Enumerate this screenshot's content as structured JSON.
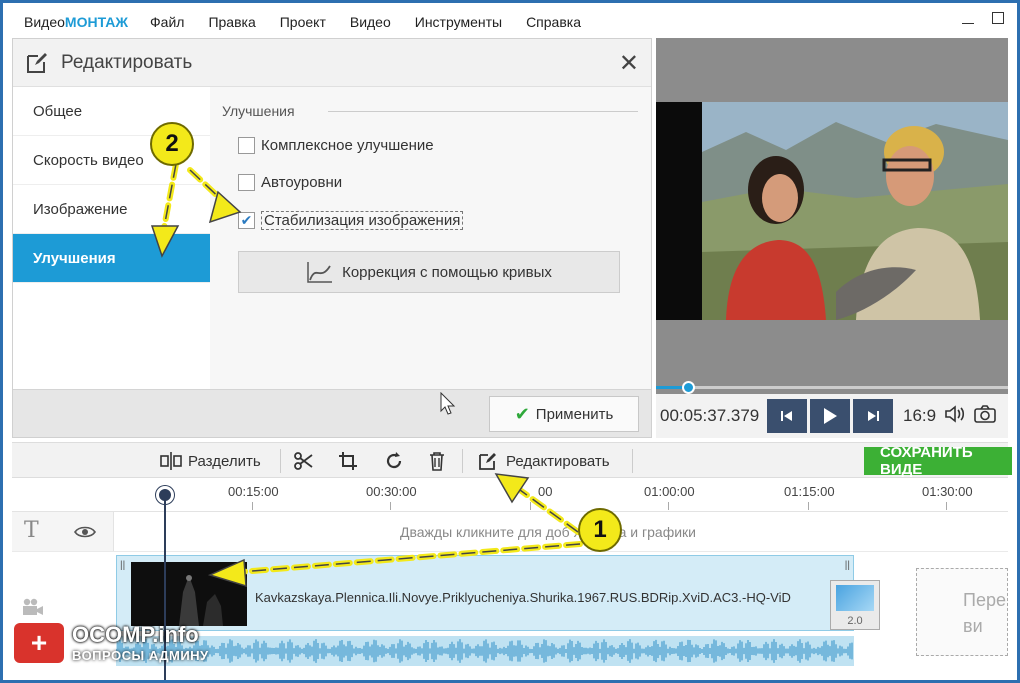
{
  "app": {
    "logo_prefix": "Видео",
    "logo_suffix": "МОНТАЖ",
    "menu": [
      "Файл",
      "Правка",
      "Проект",
      "Видео",
      "Инструменты",
      "Справка"
    ]
  },
  "edit_panel": {
    "title": "Редактировать",
    "sidebar": [
      "Общее",
      "Скорость видео",
      "Изображение",
      "Улучшения"
    ],
    "active_item": "Улучшения",
    "section_title": "Улучшения",
    "options": [
      {
        "label": "Комплексное улучшение",
        "checked": false
      },
      {
        "label": "Автоуровни",
        "checked": false
      },
      {
        "label": "Стабилизация изображения",
        "checked": true
      }
    ],
    "curves_button": "Коррекция с помощью кривых",
    "apply_button": "Применить"
  },
  "preview": {
    "timecode": "00:05:37.379",
    "aspect_ratio": "16:9",
    "progress": 0.09
  },
  "toolbar": {
    "split": "Разделить",
    "edit": "Редактировать",
    "save": "СОХРАНИТЬ ВИДЕ"
  },
  "timeline": {
    "ticks": [
      "00:15:00",
      "00:30:00",
      "00",
      "01:00:00",
      "01:15:00",
      "01:30:00"
    ],
    "text_track_hint": "Дважды кликните для доб     я текста и графики",
    "clip_name": "Kavkazskaya.Plennica.Ili.Novye.Priklyucheniya.Shurika.1967.RUS.BDRip.XviD.AC3.-HQ-ViD",
    "transition_value": "2.0",
    "drop_zone_line1": "Пере",
    "drop_zone_line2": "ви"
  },
  "watermark": {
    "title": "OCOMP.info",
    "subtitle": "ВОПРОСЫ АДМИНУ"
  },
  "annotations": {
    "badge1": "1",
    "badge2": "2",
    "accent": "#f3e91a"
  }
}
